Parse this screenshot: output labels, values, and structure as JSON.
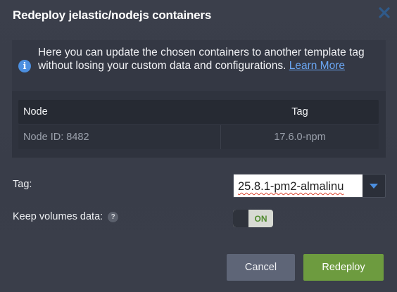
{
  "dialog": {
    "title": "Redeploy jelastic/nodejs containers",
    "close_icon": "close-icon"
  },
  "info": {
    "icon": "info-icon",
    "text": "Here you can update the chosen containers to another template tag without losing your custom data and configurations.",
    "link_text": "Learn More"
  },
  "table": {
    "headers": [
      "Node",
      "Tag"
    ],
    "rows": [
      {
        "node": "Node ID: 8482",
        "tag": "17.6.0-npm"
      }
    ]
  },
  "form": {
    "tag_label": "Tag:",
    "tag_value": "25.8.1-pm2-almalinu",
    "tag_dropdown_icon": "chevron-down-icon",
    "keep_volumes_label": "Keep volumes data:",
    "help_icon": "help-icon",
    "help_glyph": "?",
    "keep_volumes_state": "ON"
  },
  "buttons": {
    "cancel": "Cancel",
    "redeploy": "Redeploy"
  },
  "colors": {
    "accent_blue": "#4c8fe0",
    "primary_green": "#6d9b3f",
    "secondary_gray": "#5e6577",
    "toggle_on_text": "#4f8a2e"
  }
}
